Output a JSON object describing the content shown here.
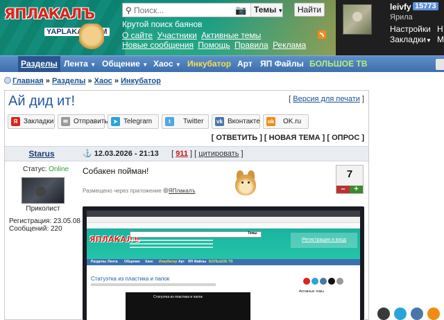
{
  "header": {
    "logo_text": "ЯПЛАКАЛЪ",
    "logo_sub": "YAPLAKAL.COM",
    "search_placeholder": "Поиск...",
    "search_scope": "Темы",
    "search_button": "Найти",
    "slogan": "Крутой поиск баянов",
    "links": [
      "О сайте",
      "Участники",
      "Активные темы",
      "Новые сообщения",
      "Помощь",
      "Правила",
      "Реклама"
    ],
    "user": {
      "name": "leivfy",
      "karma": "15773",
      "city": "Ярила",
      "menu": [
        "Настройки",
        "Закладки"
      ],
      "menu_extra": [
        "Н",
        "М"
      ]
    }
  },
  "nav": {
    "items": [
      "Разделы",
      "Лента",
      "Общение",
      "Хаос",
      "Инкубатор",
      "Арт",
      "ЯП Файлы",
      "БОЛЬШОЕ ТВ"
    ]
  },
  "breadcrumb": [
    "Главная",
    "Разделы",
    "Хаос",
    "Инкубатор"
  ],
  "topic": {
    "title": "Ай дид ит!",
    "print_label": "Версия для печати"
  },
  "share": [
    "Закладки",
    "Отправить",
    "Telegram",
    "Twitter",
    "Вконтакте",
    "OK.ru"
  ],
  "actions": [
    "ОТВЕТИТЬ",
    "НОВАЯ ТЕМА",
    "ОПРОС"
  ],
  "post": {
    "author": "Starus",
    "date": "12.03.2026 - 21:13",
    "number": "911",
    "cite": "цитировать",
    "status_label": "Статус:",
    "status_value": "Online",
    "rank": "Приколист",
    "registered": "Регистрация: 23.05.08",
    "messages": "Сообщений: 220",
    "text": "Собакен пойман!",
    "posted_via": "Размещено через приложение",
    "app_name": "ЯПлакалъ",
    "rating": "7",
    "minus": "–",
    "plus": "+"
  },
  "photo": {
    "title": "Статуэтка из пластика и папок",
    "video_title": "Статуэтка из пластика и папок",
    "register_link": "Регистрация и вход",
    "aside_title": "Активные темы",
    "scope": "Темы"
  },
  "colors": {
    "header_teal": "#1c9f86",
    "nav_blue": "#3d6fad",
    "title_blue": "#245aa0",
    "link_blue": "#1b4f96",
    "online_green": "#2aa12a",
    "post_number_red": "#c4151a"
  }
}
